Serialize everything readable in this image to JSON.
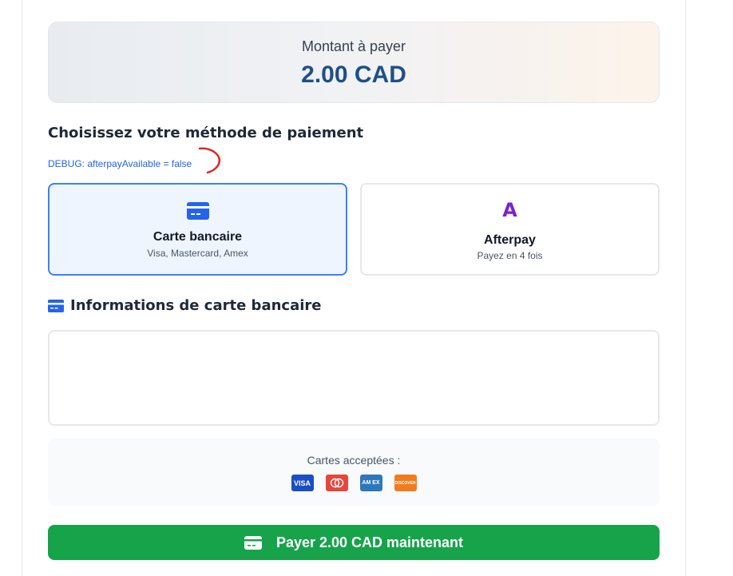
{
  "summary": {
    "label": "Montant à payer",
    "amount": "2.00 CAD"
  },
  "payment_section": {
    "title": "Choisissez votre méthode de paiement",
    "debug": "DEBUG: afterpayAvailable = false"
  },
  "methods": [
    {
      "title": "Carte bancaire",
      "subtitle": "Visa, Mastercard, Amex",
      "icon": "credit-card-icon",
      "selected": true
    },
    {
      "title": "Afterpay",
      "subtitle": "Payez en 4 fois",
      "icon": "afterpay-icon",
      "icon_text": "A",
      "selected": false
    }
  ],
  "card_info": {
    "title": "Informations de carte bancaire",
    "icon": "credit-card-icon"
  },
  "accepted": {
    "label": "Cartes acceptées :",
    "cards": [
      {
        "name": "visa",
        "text": "VISA"
      },
      {
        "name": "mastercard",
        "text": ""
      },
      {
        "name": "amex",
        "text": "AM EX"
      },
      {
        "name": "discover",
        "text": "DISCOVER"
      }
    ]
  },
  "pay_button": {
    "label": "Payer 2.00 CAD maintenant",
    "icon": "credit-card-icon"
  },
  "colors": {
    "accent": "#3b82f6",
    "amount": "#1e4f8a",
    "pay": "#16a34a",
    "afterpay": "#7e22ce",
    "debug": "#2563eb"
  }
}
